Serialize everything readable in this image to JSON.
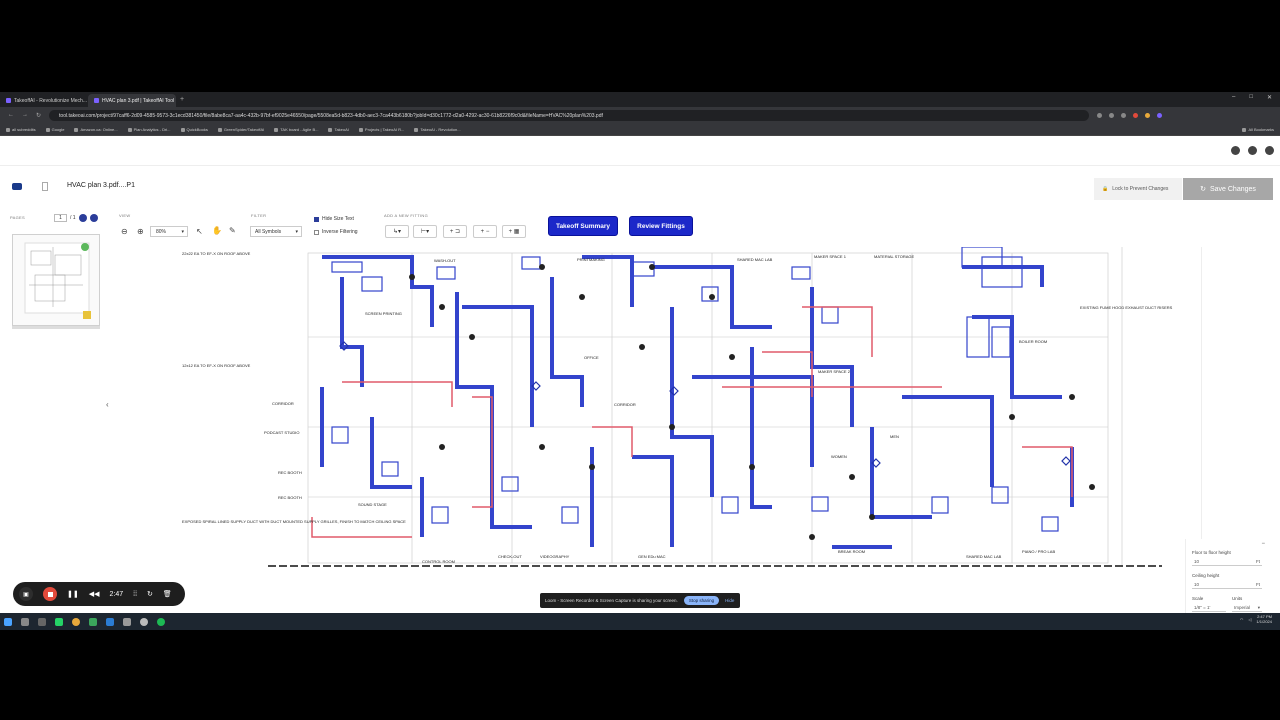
{
  "browser": {
    "tabs": [
      {
        "label": "TakeoffAI - Revolutionize Mech..."
      },
      {
        "label": "HVAC plan 3.pdf | TakeoffAI Tool"
      }
    ],
    "url": "tool.takeoai.com/project/97caff6-2d09-4585-9573-3c1ecd381450/file/8abe8ca7-aa4c-432b-97bf-ef9025e46550/page/5508ea5d-b823-4db0-aec3-7ca443b6180b?jobId=d30c1772-d2a0-4292-ac30-61b8226f9c0d&fileName=HVAC%20plan%203.pdf",
    "bookmarks": [
      "all subreddits",
      "Google",
      "Amazon.ca: Online...",
      "Plan Analytics - Dri...",
      "QuickBooks",
      "GreenSpider/TakeoffAI",
      "TAK board - Agile B...",
      "TakeoAI",
      "Projects | TakeoAI R...",
      "TakeoAI - Revolution..."
    ],
    "all_bookmarks": "All Bookmarks"
  },
  "app": {
    "file_name": "HVAC plan 3.pdf....P1",
    "lock_label": "Lock to Prevent Changes",
    "save_label": "Save Changes",
    "pages_label": "PAGES",
    "page_current": "1",
    "page_total": "/ 1",
    "view_label": "VIEW",
    "zoom_value": "80%",
    "filter_label": "FILTER",
    "filter_value": "All Symbols",
    "hide_size_text": "Hide Size Text",
    "inverse_filtering": "Inverse Filtering",
    "add_fitting_label": "ADD A NEW FITTING",
    "takeoff_summary": "Takeoff Summary",
    "review_fittings": "Review Fittings"
  },
  "drawing_labels": {
    "ea_roof_1": "22x22 EA TO EF-X ON ROOF ABOVE",
    "ea_roof_2": "12x12 EA TO EF-X ON ROOF ABOVE",
    "washout": "WASH-OUT",
    "printmaking": "PRINTMAKING",
    "shared_mac_lab": "SHARED MAC LAB",
    "maker_space_1": "MAKER SPACE 1",
    "material_storage": "MATERIAL STORAGE",
    "screen_printing": "SCREEN PRINTING",
    "corridor": "CORRIDOR",
    "podcast_studio": "PODCAST STUDIO",
    "rec_booth": "REC BOOTH",
    "rec_booth_2": "REC BOOTH",
    "sound_stage": "SOUND STAGE",
    "office": "OFFICE",
    "corridor_2": "CORRIDOR",
    "maker_space_2": "MAKER SPACE 2",
    "boiler_room": "BOILER ROOM",
    "men": "MEN",
    "women": "WOMEN",
    "break_room": "BREAK ROOM",
    "control_room": "CONTROL ROOM",
    "check_out": "CHECK-OUT",
    "videography": "VIDEOGRAPHY",
    "gen_ed": "GEN EDu MAC",
    "shared_mac_lab_2": "SHARED MAC LAB",
    "piano_lab": "PIANO / PRO LAB",
    "exhaust_note": "EXISTING FUME HOOD EXHAUST DUCT RISERS",
    "spiral_note": "EXPOSED SPIRAL LINED SUPPLY DUCT WITH DUCT MOUNTED SUPPLY GRILLES, FINISH TO MATCH CEILING SPACE"
  },
  "right_panel": {
    "floor_to_floor": "Floor to floor height",
    "floor_value": "10",
    "unit_ft": "Ft",
    "ceiling_height": "Ceiling height",
    "ceiling_value": "10",
    "unit_ft_2": "Ft",
    "scale_label": "Scale",
    "scale_value": "1/8\" = 1'",
    "units_label": "Units",
    "units_value": "Imperial"
  },
  "recorder": {
    "time": "2:47"
  },
  "share_bar": {
    "message": "Loom - Screen Recorder & Screen Capture is sharing your screen.",
    "stop": "Stop sharing",
    "hide": "Hide"
  },
  "tray": {
    "time": "2:47 PM",
    "date": "1/1/2024"
  },
  "colors": {
    "accent": "#1c28c9",
    "duct": "#3344cc",
    "red_duct": "#e05a6a"
  }
}
